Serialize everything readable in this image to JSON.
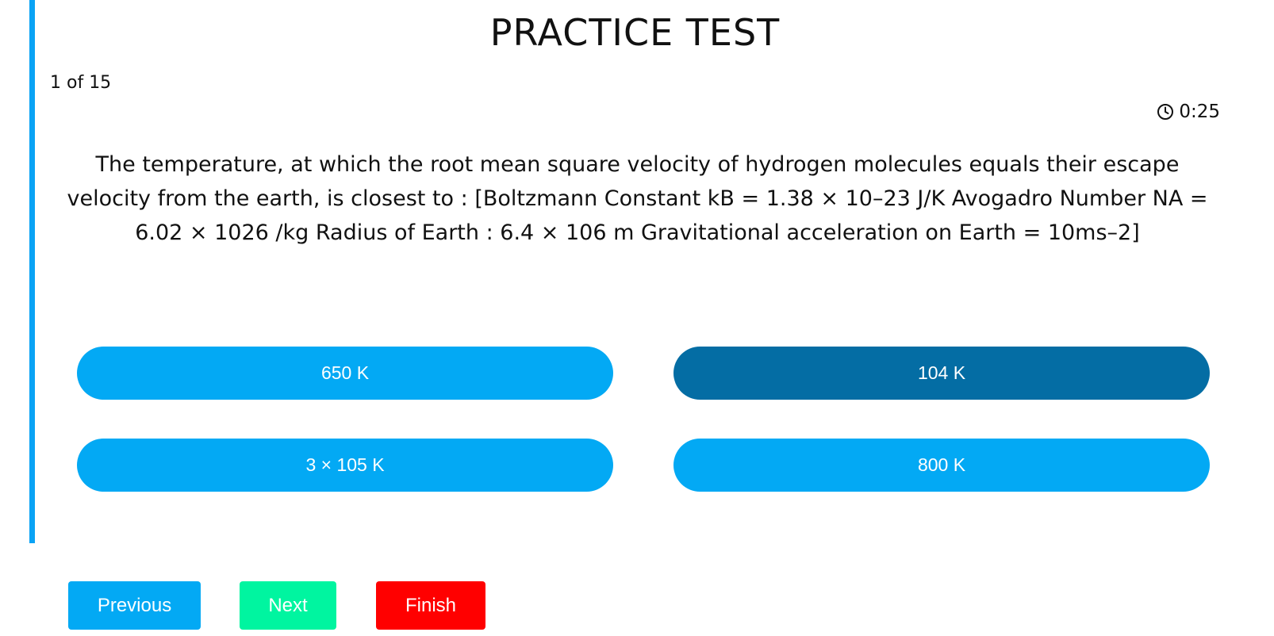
{
  "header": {
    "title": "PRACTICE TEST",
    "counter": "1 of 15",
    "timer": "0:25",
    "timer_icon": "clock-icon"
  },
  "question": {
    "text": "The temperature, at which the root mean square velocity of hydrogen molecules equals their escape velocity from the earth, is closest to : [Boltzmann Constant kB = 1.38 × 10–23 J/K Avogadro Number NA = 6.02 × 1026 /kg Radius of Earth : 6.4 × 106 m Gravitational acceleration on Earth = 10ms–2]"
  },
  "options": [
    {
      "label": "650 K",
      "selected": false
    },
    {
      "label": "104 K",
      "selected": true
    },
    {
      "label": "3 × 105 K",
      "selected": false
    },
    {
      "label": "800 K",
      "selected": false
    }
  ],
  "navigation": {
    "previous_label": "Previous",
    "next_label": "Next",
    "finish_label": "Finish"
  },
  "colors": {
    "accent": "#03a9f4",
    "option_selected": "#046da4",
    "next": "#00f5a0",
    "finish": "#ff0000"
  }
}
